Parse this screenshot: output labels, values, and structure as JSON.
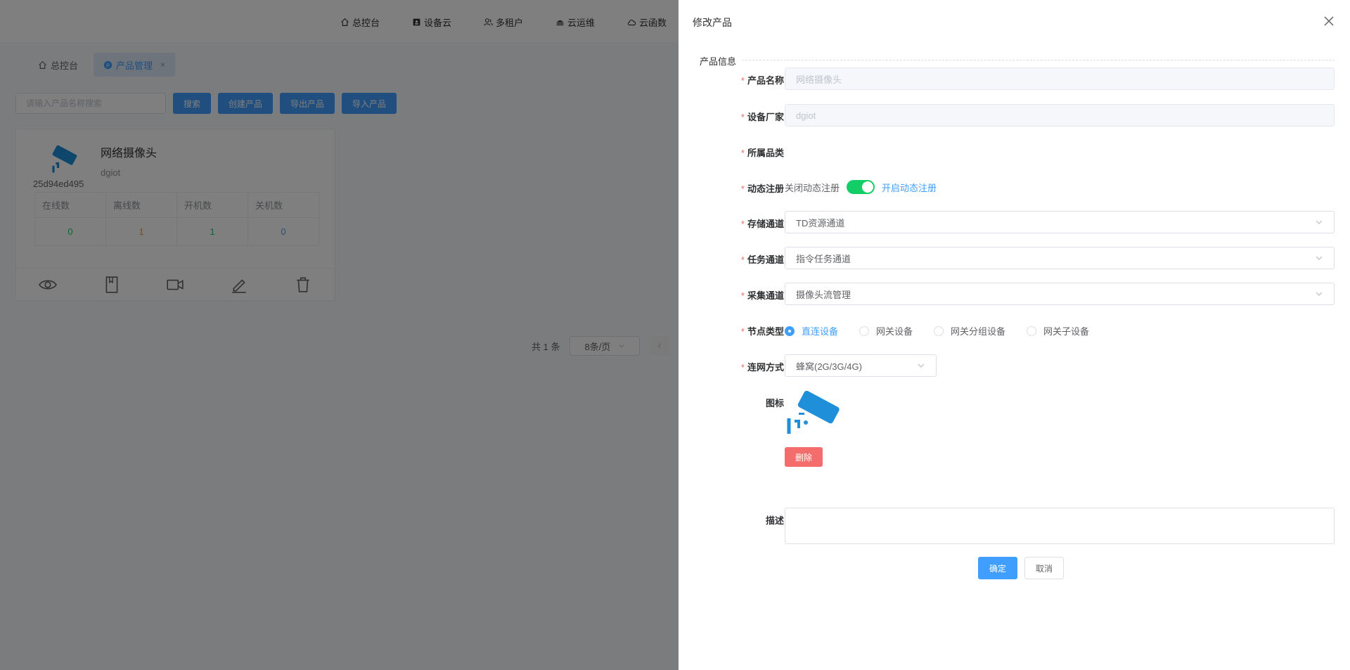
{
  "topnav": {
    "items": [
      {
        "label": "总控台",
        "icon": "home-icon"
      },
      {
        "label": "设备云",
        "icon": "device-icon"
      },
      {
        "label": "多租户",
        "icon": "users-icon"
      },
      {
        "label": "云运维",
        "icon": "cloud-ops-icon"
      },
      {
        "label": "云函数",
        "icon": "cloud-icon"
      }
    ]
  },
  "tabs": [
    {
      "label": "总控台",
      "icon": "home-icon"
    },
    {
      "label": "产品管理",
      "icon": "product-icon",
      "close": "×"
    }
  ],
  "toolbar": {
    "search_placeholder": "请输入产品名称搜索",
    "search_button": "搜索",
    "create_button": "创建产品",
    "export_button": "导出产品",
    "import_button": "导入产品"
  },
  "product_card": {
    "id": "25d94ed495",
    "name": "网络摄像头",
    "maker": "dgiot",
    "stats_headers": [
      "在线数",
      "离线数",
      "开机数",
      "关机数"
    ],
    "stats_values": [
      "0",
      "1",
      "1",
      "0"
    ],
    "stats_colors": [
      "#13ce66",
      "#e6a23c",
      "#13ce66",
      "#409eff"
    ],
    "actions": [
      "eye-icon",
      "document-icon",
      "video-icon",
      "edit-icon",
      "trash-icon"
    ]
  },
  "pagination": {
    "total": "共 1 条",
    "page_size": "8条/页"
  },
  "drawer": {
    "title": "修改产品",
    "section": "产品信息",
    "fields": {
      "name_label": "产品名称",
      "name_value": "网络摄像头",
      "maker_label": "设备厂家",
      "maker_value": "dgiot",
      "category_label": "所属品类",
      "dynreg_label": "动态注册",
      "dynreg_off": "关闭动态注册",
      "dynreg_on": "开启动态注册",
      "dynreg_enabled": true,
      "storage_label": "存储通道",
      "storage_value": "TD资源通道",
      "task_label": "任务通道",
      "task_value": "指令任务通道",
      "collect_label": "采集通道",
      "collect_value": "摄像头流管理",
      "node_label": "节点类型",
      "node_options": [
        "直连设备",
        "网关设备",
        "网关分组设备",
        "网关子设备"
      ],
      "node_selected": "直连设备",
      "network_label": "连网方式",
      "network_value": "蜂窝(2G/3G/4G)",
      "icon_label": "图标",
      "delete_button": "删除",
      "desc_label": "描述",
      "desc_value": ""
    },
    "ok_button": "确定",
    "cancel_button": "取消"
  },
  "colors": {
    "primary": "#409eff",
    "danger": "#f56c6c",
    "success": "#13ce66",
    "camera_icon": "#1e8fd8"
  }
}
